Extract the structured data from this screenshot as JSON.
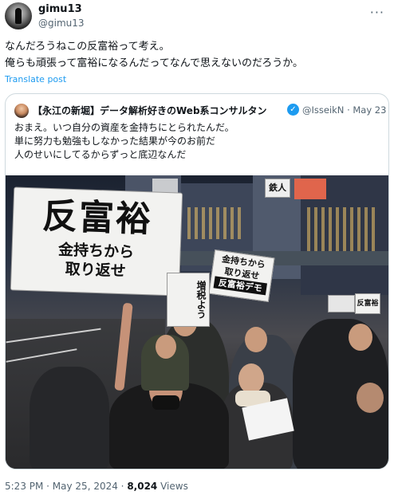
{
  "author": {
    "name": "gimu13",
    "handle": "@gimu13"
  },
  "more_label": "···",
  "tweet": {
    "line1": "なんだろうねこの反富裕って考え。",
    "line2": "俺らも頑張って富裕になるんだってなんで思えないのだろうか。"
  },
  "translate_label": "Translate post",
  "quote": {
    "name": "【永江の新堀】データ解析好きのWeb系コンサルタン",
    "verified_mark": "✓",
    "handle_date": "@IsseikN · May 23",
    "line1": "おまえ。いつ自分の資産を金持ちにとられたんだ。",
    "line2": "単に努力も勉強もしなかった結果が今のお前だ",
    "line3": "人のせいにしてるからずっと底辺なんだ",
    "photo_signs": {
      "main_big": "反富裕",
      "main_small1": "金持ちから",
      "main_small2": "取り返せ",
      "right_line1": "金持ちから",
      "right_line2": "取り返せ",
      "right_line3": "反富裕デモ",
      "left_mid": "増税よう",
      "store1": "鉄人",
      "right_small": "反富裕"
    }
  },
  "footer": {
    "time_date": "5:23 PM · May 25, 2024 · ",
    "views_count": "8,024",
    "views_label": " Views"
  }
}
